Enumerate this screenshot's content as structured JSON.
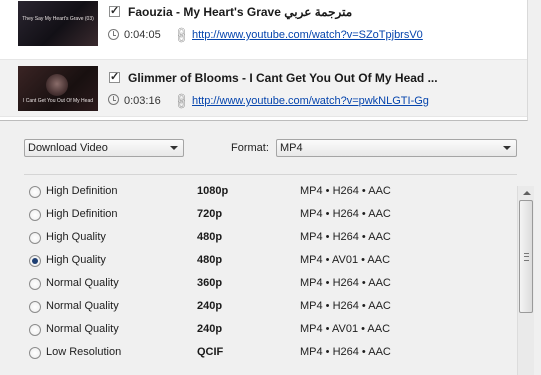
{
  "videos": [
    {
      "checked": true,
      "title": "Faouzia - My Heart's Grave مترجمة عربي",
      "duration": "0:04:05",
      "url": "http://www.youtube.com/watch?v=SZoTpjbrsV0",
      "thumb_caption": "They Say My Heart's Grave (03)"
    },
    {
      "checked": true,
      "title": "Glimmer of Blooms - I Cant Get You Out Of My Head ...",
      "duration": "0:03:16",
      "url": "http://www.youtube.com/watch?v=pwkNLGTI-Gg",
      "thumb_caption": "I Cant Get You Out Of My Head"
    }
  ],
  "download": {
    "selected": "Download Video"
  },
  "format": {
    "label": "Format:",
    "selected": "MP4"
  },
  "qualities": [
    {
      "name": "High Definition",
      "resolution": "1080p",
      "codec": "MP4 • H264 • AAC",
      "selected": false
    },
    {
      "name": "High Definition",
      "resolution": "720p",
      "codec": "MP4 • H264 • AAC",
      "selected": false
    },
    {
      "name": "High Quality",
      "resolution": "480p",
      "codec": "MP4 • H264 • AAC",
      "selected": false
    },
    {
      "name": "High Quality",
      "resolution": "480p",
      "codec": "MP4 • AV01 • AAC",
      "selected": true
    },
    {
      "name": "Normal Quality",
      "resolution": "360p",
      "codec": "MP4 • H264 • AAC",
      "selected": false
    },
    {
      "name": "Normal Quality",
      "resolution": "240p",
      "codec": "MP4 • H264 • AAC",
      "selected": false
    },
    {
      "name": "Normal Quality",
      "resolution": "240p",
      "codec": "MP4 • AV01 • AAC",
      "selected": false
    },
    {
      "name": "Low Resolution",
      "resolution": "QCIF",
      "codec": "MP4 • H264 • AAC",
      "selected": false
    }
  ],
  "colors": {
    "link": "#0645ad",
    "radio_selected": "#1e3f73"
  },
  "icons": {
    "checkbox": "check-icon",
    "duration": "clock-icon",
    "url": "link-icon",
    "dropdown": "chevron-down-icon"
  }
}
